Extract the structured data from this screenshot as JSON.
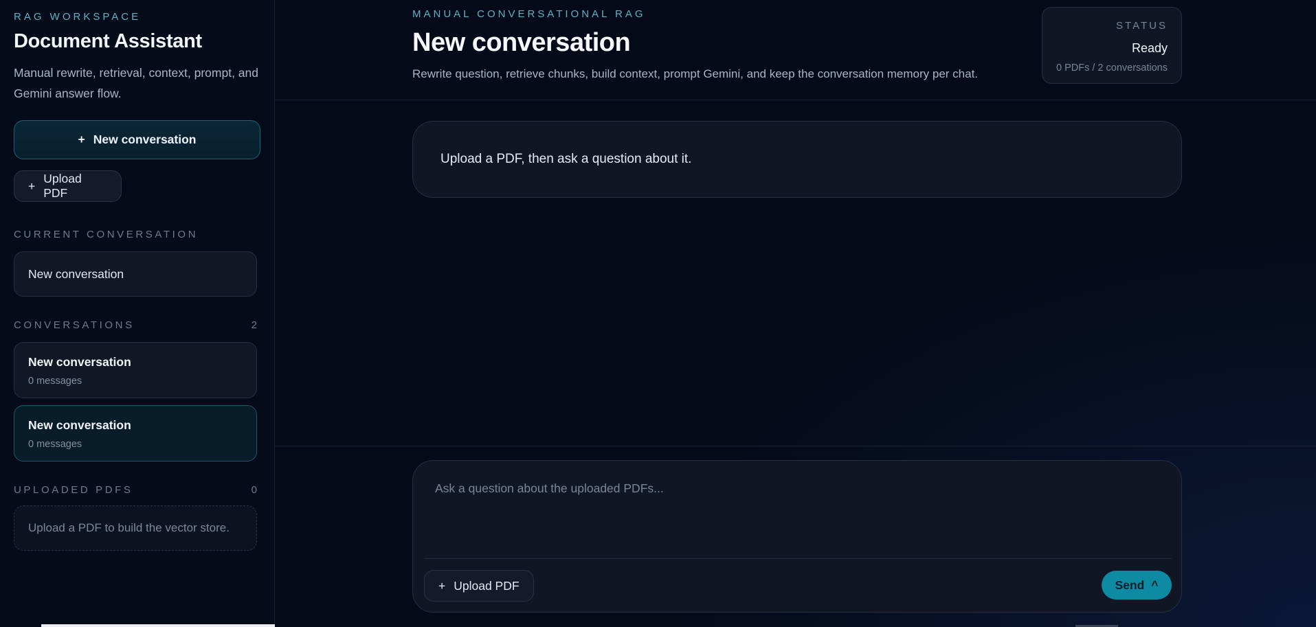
{
  "sidebar": {
    "eyebrow": "RAG WORKSPACE",
    "title": "Document Assistant",
    "description": "Manual rewrite, retrieval, context, prompt, and Gemini answer flow.",
    "new_conversation_label": "New conversation",
    "upload_label": "Upload PDF",
    "plus_icon": "+",
    "current_section": "CURRENT CONVERSATION",
    "current_conversation": "New conversation",
    "conversations_section": "CONVERSATIONS",
    "conversations_count": "2",
    "conversations": [
      {
        "title": "New conversation",
        "meta": "0 messages",
        "active": false
      },
      {
        "title": "New conversation",
        "meta": "0 messages",
        "active": true
      }
    ],
    "pdfs_section": "UPLOADED PDFS",
    "pdfs_count": "0",
    "pdfs_empty": "Upload a PDF to build the vector store."
  },
  "header": {
    "eyebrow": "MANUAL CONVERSATIONAL RAG",
    "title": "New conversation",
    "description": "Rewrite question, retrieve chunks, build context, prompt Gemini, and keep the conversation memory per chat."
  },
  "status": {
    "label": "STATUS",
    "value": "Ready",
    "meta": "0 PDFs / 2 conversations"
  },
  "messages": {
    "empty_prompt": "Upload a PDF, then ask a question about it."
  },
  "composer": {
    "placeholder": "Ask a question about the uploaded PDFs...",
    "upload_label": "Upload PDF",
    "send_label": "Send",
    "send_icon": "^"
  },
  "colors": {
    "accent": "#0f8aa3",
    "eyebrow": "#5fb2c4",
    "background": "#050a18"
  }
}
